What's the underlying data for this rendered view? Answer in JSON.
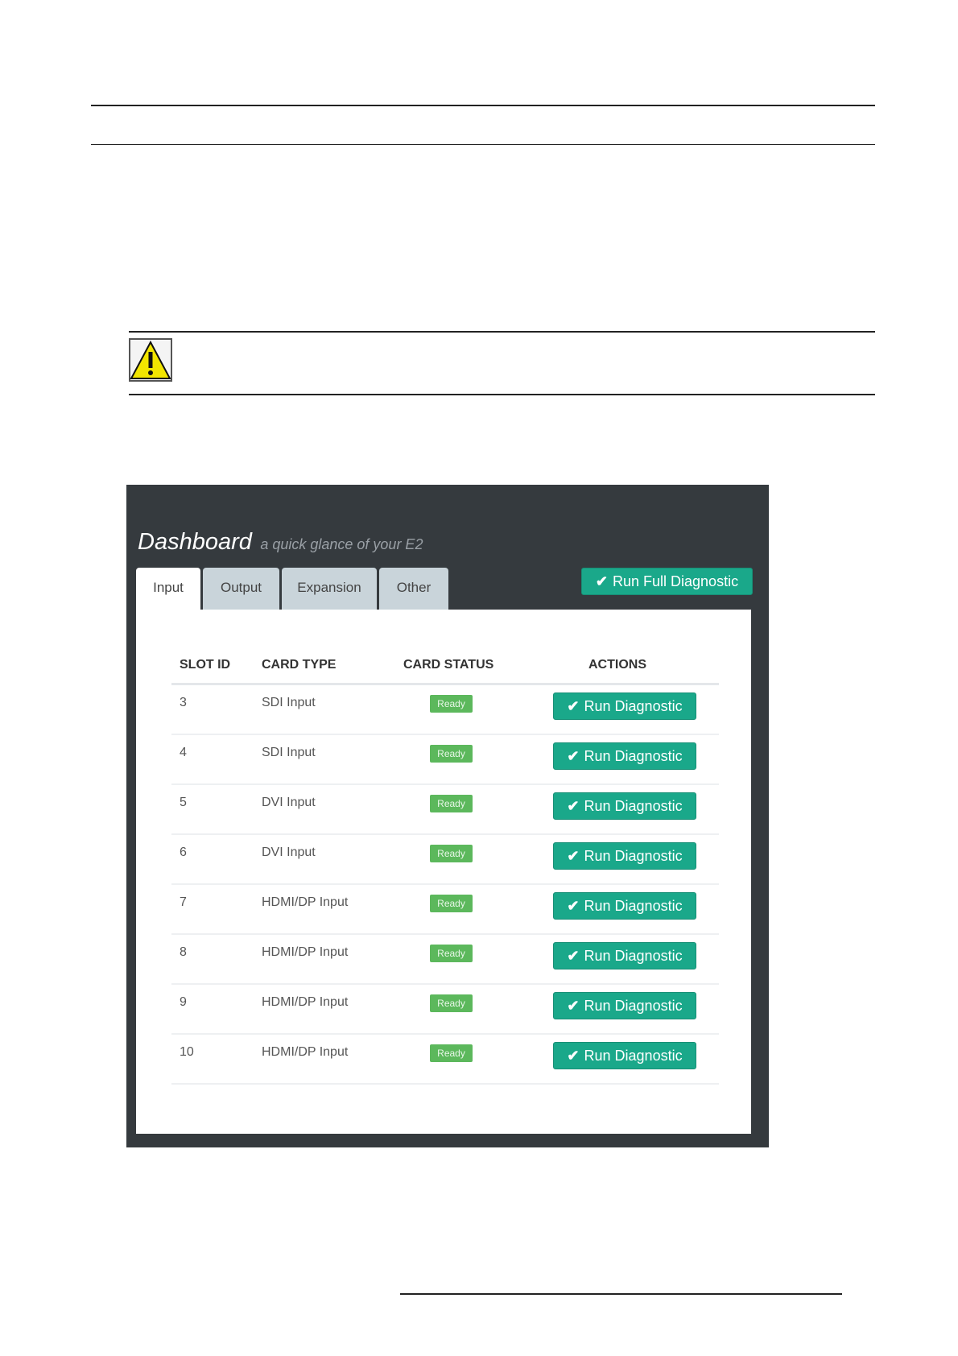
{
  "dashboard": {
    "title": "Dashboard",
    "subtitle": "a quick glance of your E2",
    "full_diagnostic_label": "Run Full Diagnostic",
    "tabs": [
      {
        "label": "Input",
        "active": true
      },
      {
        "label": "Output",
        "active": false
      },
      {
        "label": "Expansion",
        "active": false
      },
      {
        "label": "Other",
        "active": false
      }
    ],
    "columns": {
      "slot_id": "SLOT ID",
      "card_type": "CARD TYPE",
      "card_status": "CARD STATUS",
      "actions": "ACTIONS"
    },
    "rows": [
      {
        "slot": "3",
        "type": "SDI Input",
        "status": "Ready",
        "action": "Run Diagnostic"
      },
      {
        "slot": "4",
        "type": "SDI Input",
        "status": "Ready",
        "action": "Run Diagnostic"
      },
      {
        "slot": "5",
        "type": "DVI Input",
        "status": "Ready",
        "action": "Run Diagnostic"
      },
      {
        "slot": "6",
        "type": "DVI Input",
        "status": "Ready",
        "action": "Run Diagnostic"
      },
      {
        "slot": "7",
        "type": "HDMI/DP Input",
        "status": "Ready",
        "action": "Run Diagnostic"
      },
      {
        "slot": "8",
        "type": "HDMI/DP Input",
        "status": "Ready",
        "action": "Run Diagnostic"
      },
      {
        "slot": "9",
        "type": "HDMI/DP Input",
        "status": "Ready",
        "action": "Run Diagnostic"
      },
      {
        "slot": "10",
        "type": "HDMI/DP Input",
        "status": "Ready",
        "action": "Run Diagnostic"
      }
    ]
  },
  "colors": {
    "accent": "#1aa88a",
    "ready_badge": "#5cb85c",
    "frame": "#353a3e",
    "tab_inactive": "#c9d4da",
    "warning_yellow": "#f2e500"
  },
  "icons": {
    "warning": "warning-icon",
    "check": "check-icon"
  }
}
